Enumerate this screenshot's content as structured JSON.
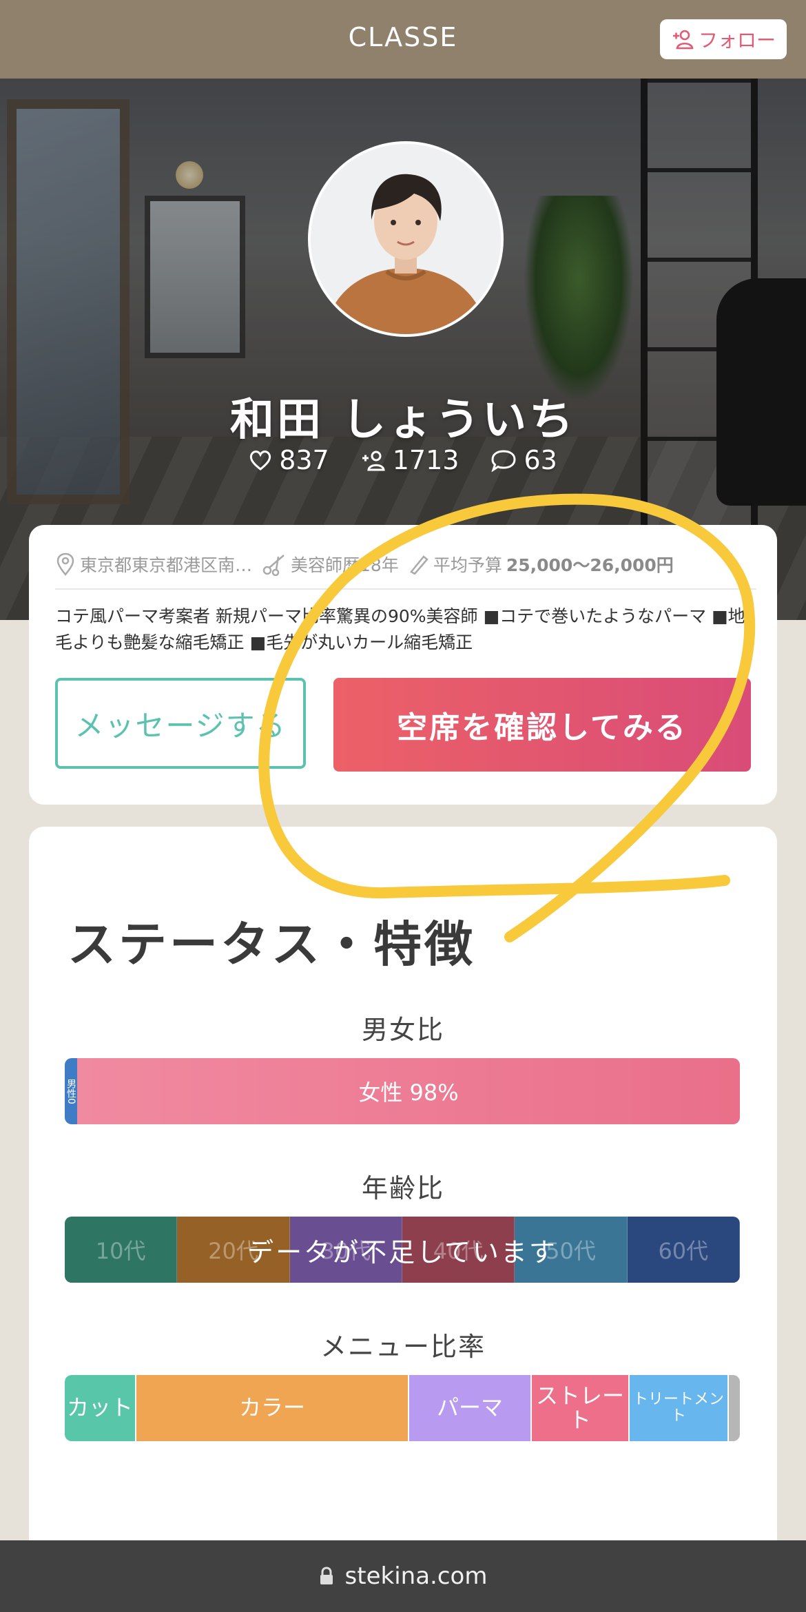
{
  "header": {
    "brand": "CLASSE",
    "follow_label": "フォロー"
  },
  "profile": {
    "name": "和田 しょういち",
    "stats": {
      "likes": "837",
      "followers": "1713",
      "comments": "63"
    }
  },
  "info": {
    "location": "東京都東京都港区南…",
    "experience": "美容師歴18年",
    "budget_label": "平均予算",
    "budget_value": "25,000〜26,000円"
  },
  "intro": "コテ風パーマ考案者 新規パーマ比率驚異の90%美容師 ■コテで巻いたようなパーマ ■地毛よりも艶髪な縮毛矯正 ■毛先が丸いカール縮毛矯正",
  "actions": {
    "message_label": "メッセージする",
    "reserve_label": "空席を確認してみる"
  },
  "status": {
    "title": "ステータス・特徴",
    "gender": {
      "title": "男女比",
      "male_label": "男性0",
      "female_label": "女性 98%",
      "female_percent": 98
    },
    "age": {
      "title": "年齢比",
      "groups": [
        "10代",
        "20代",
        "30代",
        "40代",
        "50代",
        "60代"
      ],
      "colors": [
        "#2e7564",
        "#966126",
        "#6a4e92",
        "#8e3f4e",
        "#3a7596",
        "#2a477e"
      ],
      "message": "データが不足しています"
    },
    "menu": {
      "title": "メニュー比率",
      "items": [
        "カット",
        "カラー",
        "パーマ",
        "ストレート",
        "トリートメント"
      ]
    }
  },
  "footer": {
    "url": "stekina.com"
  },
  "theme": {
    "header_bg": "#8f816c",
    "accent_pink": "#e45a73",
    "accent_teal": "#5cc2b0",
    "annotation": "#f7c93b"
  }
}
